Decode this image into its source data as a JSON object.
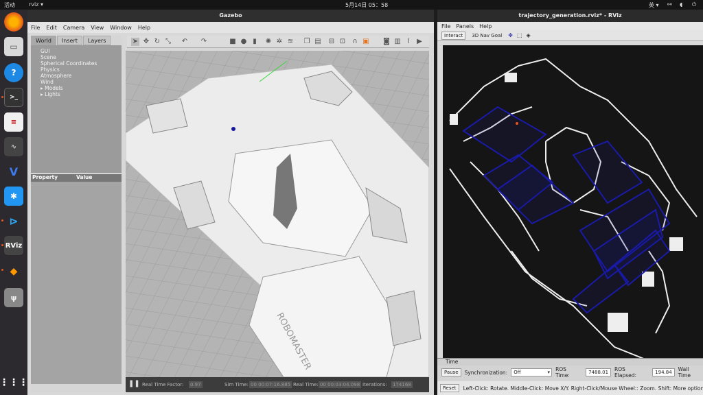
{
  "topbar": {
    "activities": "活动",
    "app": "rviz ▾",
    "clock": "5月14日 05：58",
    "ime": "英 ▾"
  },
  "gazebo": {
    "title": "Gazebo",
    "menu": [
      "File",
      "Edit",
      "Camera",
      "View",
      "Window",
      "Help"
    ],
    "tabs": [
      "World",
      "Insert",
      "Layers"
    ],
    "tree": [
      "GUI",
      "Scene",
      "Spherical Coordinates",
      "Physics",
      "Atmosphere",
      "Wind",
      "▸ Models",
      "▸ Lights"
    ],
    "prop_header": [
      "Property",
      "Value"
    ],
    "status": {
      "rtf_label": "Real Time Factor:",
      "rtf": "0.97",
      "sim_label": "Sim Time:",
      "sim": "00 00:07:16.885",
      "real_label": "Real Time:",
      "real": "00 00:03:04.098",
      "iter_label": "Iterations:",
      "iter": "174168"
    },
    "map_text": "ROBOMASTER"
  },
  "rviz": {
    "title": "trajectory_generation.rviz* - RViz",
    "menu": [
      "File",
      "Panels",
      "Help"
    ],
    "tools": {
      "interact": "Interact",
      "nav_goal": "3D Nav Goal"
    },
    "time": {
      "header": "Time",
      "pause": "Pause",
      "sync_label": "Synchronization:",
      "sync": "Off",
      "ros_time_label": "ROS Time:",
      "ros_time": "7488.01",
      "ros_elapsed_label": "ROS Elapsed:",
      "ros_elapsed": "194.84",
      "wall_label": "Wall Time"
    },
    "help": {
      "reset": "Reset",
      "text": "Left-Click: Rotate. Middle-Click: Move X/Y. Right-Click/Mouse Wheel:: Zoom. Shift: More option"
    }
  },
  "colors": {
    "accent": "#e95420",
    "path_blue": "#1a1aa8"
  }
}
